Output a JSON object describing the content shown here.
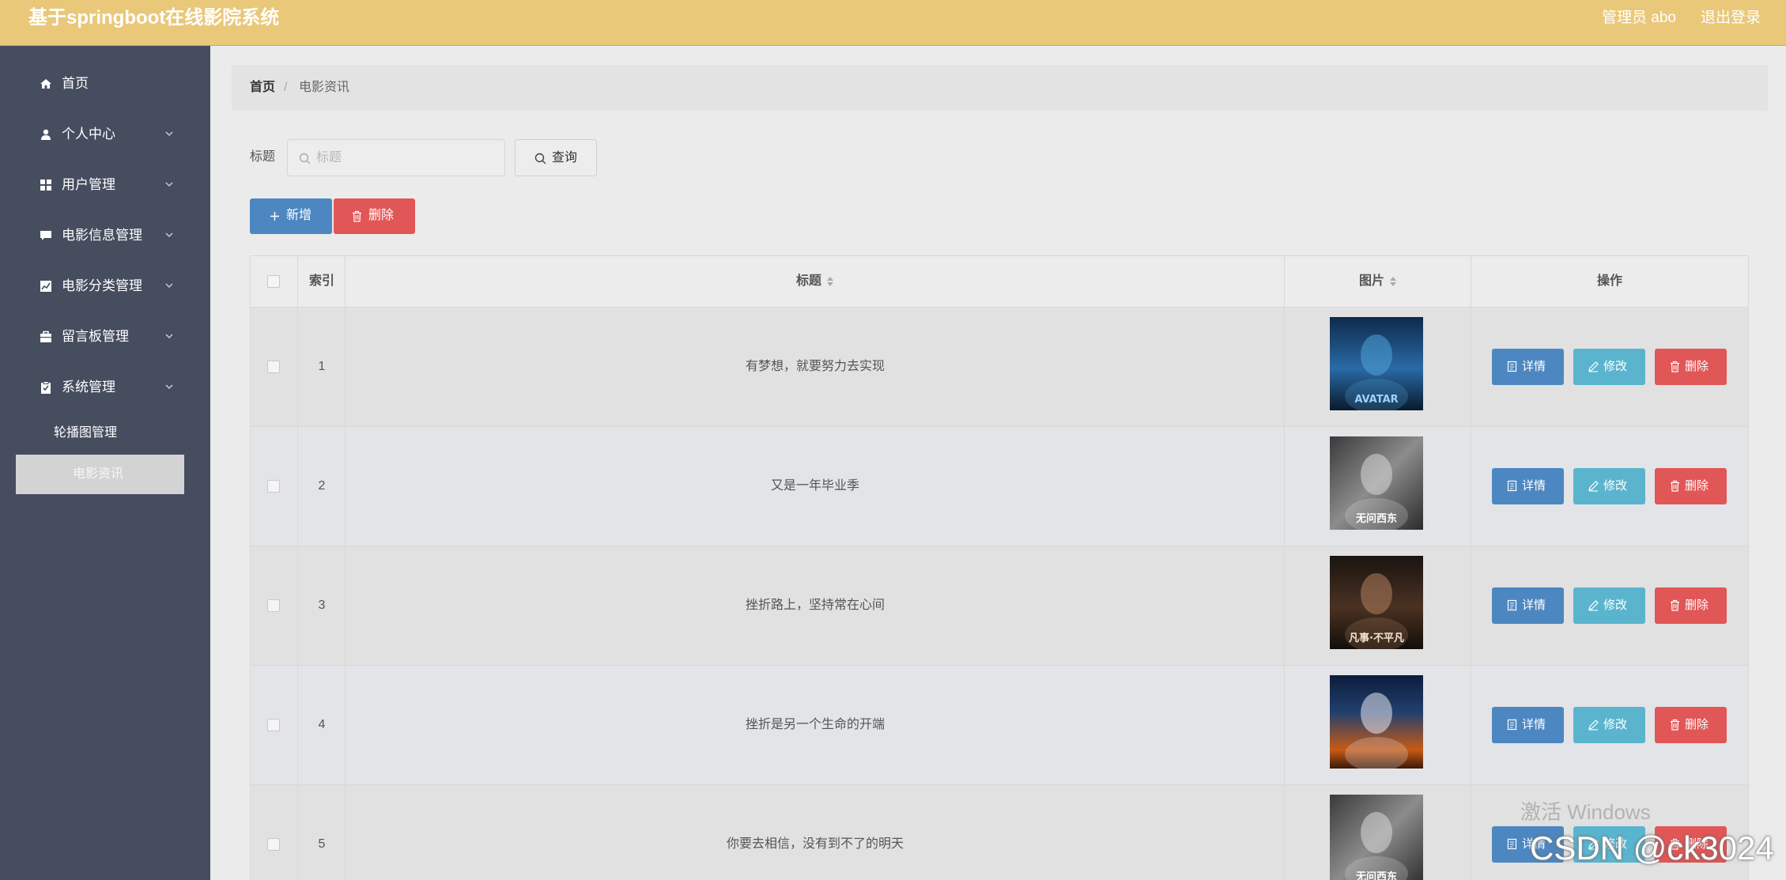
{
  "header": {
    "title": "基于springboot在线影院系统",
    "admin": "管理员 abo",
    "logout": "退出登录"
  },
  "sidebar": {
    "items": [
      {
        "label": "首页",
        "icon": "home-icon",
        "expandable": false
      },
      {
        "label": "个人中心",
        "icon": "user-icon",
        "expandable": true
      },
      {
        "label": "用户管理",
        "icon": "grid-icon",
        "expandable": true
      },
      {
        "label": "电影信息管理",
        "icon": "comment-icon",
        "expandable": true
      },
      {
        "label": "电影分类管理",
        "icon": "chart-icon",
        "expandable": true
      },
      {
        "label": "留言板管理",
        "icon": "briefcase-icon",
        "expandable": true
      },
      {
        "label": "系统管理",
        "icon": "clipboard-icon",
        "expandable": true
      }
    ],
    "subitems": [
      {
        "label": "轮播图管理",
        "active": false
      },
      {
        "label": "电影资讯",
        "active": true
      }
    ]
  },
  "breadcrumb": {
    "home": "首页",
    "separator": "/",
    "current": "电影资讯"
  },
  "search": {
    "label": "标题",
    "placeholder": "标题",
    "query_label": "查询"
  },
  "actions": {
    "add_label": "新增",
    "delete_label": "删除"
  },
  "table": {
    "columns": [
      "索引",
      "标题",
      "图片",
      "操作"
    ],
    "rows": [
      {
        "index": "1",
        "title": "有梦想，就要努力去实现",
        "poster_text": "AVATAR",
        "poster_theme": "blue"
      },
      {
        "index": "2",
        "title": "又是一年毕业季",
        "poster_text": "无问西东",
        "poster_theme": "gray"
      },
      {
        "index": "3",
        "title": "挫折路上，坚持常在心间",
        "poster_text": "凡事·不平凡",
        "poster_theme": "dark"
      },
      {
        "index": "4",
        "title": "挫折是另一个生命的开端",
        "poster_text": "",
        "poster_theme": "fire"
      },
      {
        "index": "5",
        "title": "你要去相信，没有到不了的明天",
        "poster_text": "无问西东",
        "poster_theme": "gray"
      }
    ],
    "row_actions": {
      "detail": "详情",
      "edit": "修改",
      "delete": "删除"
    }
  },
  "watermarks": {
    "windows": "激活 Windows",
    "csdn": "CSDN @ck3024"
  },
  "colors": {
    "header_bg": "#e9c87a",
    "sidebar_bg": "#464d5f",
    "primary": "#4d87c1",
    "info": "#5ab4ce",
    "danger": "#e15656"
  }
}
